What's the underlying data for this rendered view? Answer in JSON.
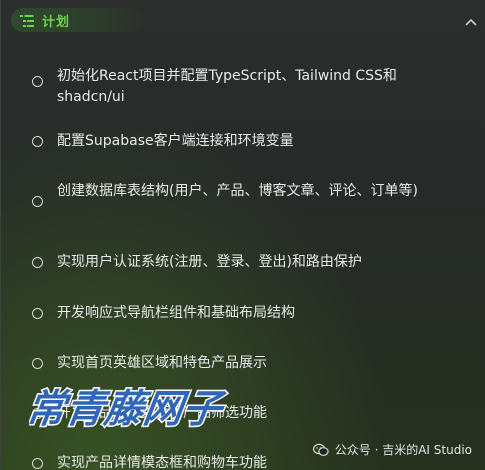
{
  "plan": {
    "title": "计划",
    "icon": "task-list-icon",
    "collapse_icon": "chevron-up-icon",
    "accent_color": "#6fd34a"
  },
  "tasks": [
    {
      "label": "初始化React项目并配置TypeScript、Tailwind CSS和shadcn/ui",
      "done": false
    },
    {
      "label": "配置Supabase客户端连接和环境变量",
      "done": false
    },
    {
      "label": "创建数据库表结构(用户、产品、博客文章、评论、订单等)",
      "done": false
    },
    {
      "label": "实现用户认证系统(注册、登录、登出)和路由保护",
      "done": false
    },
    {
      "label": "开发响应式导航栏组件和基础布局结构",
      "done": false
    },
    {
      "label": "实现首页英雄区域和特色产品展示",
      "done": false
    },
    {
      "label": "开发产品列表页面和产品筛选功能",
      "done": false
    },
    {
      "label": "实现产品详情模态框和购物车功能",
      "done": false
    }
  ],
  "watermark": {
    "brand": "常青藤网子",
    "source": "公众号 · 吉米的AI Studio",
    "source_icon": "wechat-icon"
  }
}
